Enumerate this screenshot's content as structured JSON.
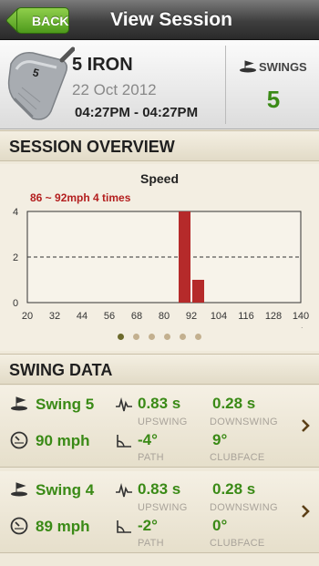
{
  "nav": {
    "back_label": "BACK",
    "title": "View Session"
  },
  "header": {
    "club_badge": "5",
    "club_name": "5 IRON",
    "date": "22 Oct 2012",
    "time_range": "04:27PM -  04:27PM",
    "swings_label": "SWINGS",
    "swings_count": "5"
  },
  "sections": {
    "overview": "SESSION OVERVIEW",
    "swing_data": "SWING DATA"
  },
  "chart_data": {
    "type": "bar",
    "title": "Speed",
    "annotation": "86 ~ 92mph 4 times",
    "x_ticks": [
      "20",
      "32",
      "44",
      "56",
      "68",
      "80",
      "92",
      "104",
      "116",
      "128",
      "140"
    ],
    "x_unit": "mph",
    "y_ticks": [
      "0",
      "2",
      "4"
    ],
    "xlim": [
      20,
      140
    ],
    "ylim": [
      0,
      4
    ],
    "reference_line_y": 2,
    "bins": [
      {
        "x_start": 86,
        "x_end": 92,
        "value": 4
      },
      {
        "x_start": 92,
        "x_end": 98,
        "value": 1
      }
    ],
    "bar_color": "#b52a2a",
    "grid": false,
    "page_dots": 6,
    "active_dot": 0
  },
  "swings": [
    {
      "name": "Swing 5",
      "speed": "90 mph",
      "upswing": "0.83 s",
      "downswing": "0.28 s",
      "path": "-4°",
      "clubface": "9°",
      "upswing_label": "UPSWING",
      "downswing_label": "DOWNSWING",
      "path_label": "PATH",
      "clubface_label": "CLUBFACE"
    },
    {
      "name": "Swing 4",
      "speed": "89 mph",
      "upswing": "0.83 s",
      "downswing": "0.28 s",
      "path": "-2°",
      "clubface": "0°",
      "upswing_label": "UPSWING",
      "downswing_label": "DOWNSWING",
      "path_label": "PATH",
      "clubface_label": "CLUBFACE"
    }
  ],
  "colors": {
    "accent_green": "#3a8a16",
    "bar_red": "#b52a2a"
  },
  "icons": [
    "golf-flag-icon",
    "speed-dial-icon",
    "tempo-wave-icon",
    "path-angle-icon",
    "chevron-right-icon"
  ]
}
